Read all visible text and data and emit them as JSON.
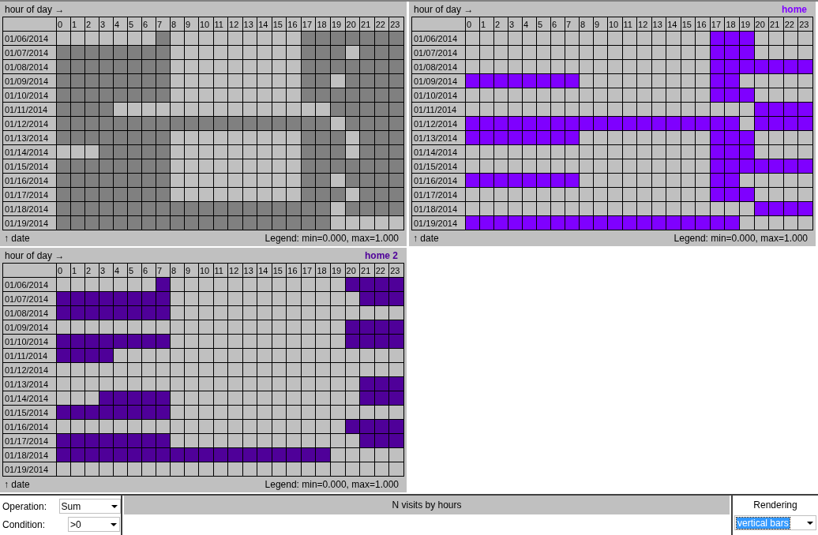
{
  "panels": [
    {
      "x_axis": "hour of day →",
      "y_axis": "↑ date",
      "legend": "Legend: min=0.000, max=1.000",
      "color": "#808080",
      "hours": [
        "0",
        "1",
        "2",
        "3",
        "4",
        "5",
        "6",
        "7",
        "8",
        "9",
        "10",
        "11",
        "12",
        "13",
        "14",
        "15",
        "16",
        "17",
        "18",
        "19",
        "20",
        "21",
        "22",
        "23"
      ],
      "rows": [
        {
          "date": "01/06/2014",
          "cells": [
            false,
            false,
            false,
            false,
            false,
            false,
            false,
            true,
            false,
            false,
            false,
            false,
            false,
            false,
            false,
            false,
            false,
            true,
            true,
            true,
            true,
            true,
            true,
            true
          ]
        },
        {
          "date": "01/07/2014",
          "cells": [
            true,
            true,
            true,
            true,
            true,
            true,
            true,
            true,
            false,
            false,
            false,
            false,
            false,
            false,
            false,
            false,
            false,
            true,
            true,
            true,
            false,
            true,
            true,
            true
          ]
        },
        {
          "date": "01/08/2014",
          "cells": [
            true,
            true,
            true,
            true,
            true,
            true,
            true,
            true,
            false,
            false,
            false,
            false,
            false,
            false,
            false,
            false,
            false,
            true,
            true,
            true,
            true,
            true,
            true,
            true
          ]
        },
        {
          "date": "01/09/2014",
          "cells": [
            true,
            true,
            true,
            true,
            true,
            true,
            true,
            true,
            false,
            false,
            false,
            false,
            false,
            false,
            false,
            false,
            false,
            true,
            true,
            false,
            true,
            true,
            true,
            true
          ]
        },
        {
          "date": "01/10/2014",
          "cells": [
            true,
            true,
            true,
            true,
            true,
            true,
            true,
            true,
            false,
            false,
            false,
            false,
            false,
            false,
            false,
            false,
            false,
            true,
            true,
            true,
            true,
            true,
            true,
            true
          ]
        },
        {
          "date": "01/11/2014",
          "cells": [
            true,
            true,
            true,
            true,
            false,
            false,
            false,
            false,
            false,
            false,
            false,
            false,
            false,
            false,
            false,
            false,
            false,
            false,
            false,
            true,
            true,
            true,
            true,
            true
          ]
        },
        {
          "date": "01/12/2014",
          "cells": [
            true,
            true,
            true,
            true,
            true,
            true,
            true,
            true,
            true,
            true,
            true,
            true,
            true,
            true,
            true,
            true,
            true,
            true,
            true,
            false,
            true,
            true,
            true,
            true
          ]
        },
        {
          "date": "01/13/2014",
          "cells": [
            true,
            true,
            true,
            true,
            true,
            true,
            true,
            true,
            false,
            false,
            false,
            false,
            false,
            false,
            false,
            false,
            false,
            true,
            true,
            true,
            false,
            true,
            true,
            true
          ]
        },
        {
          "date": "01/14/2014",
          "cells": [
            false,
            false,
            false,
            true,
            true,
            true,
            true,
            true,
            false,
            false,
            false,
            false,
            false,
            false,
            false,
            false,
            false,
            true,
            true,
            true,
            false,
            true,
            true,
            true
          ]
        },
        {
          "date": "01/15/2014",
          "cells": [
            true,
            true,
            true,
            true,
            true,
            true,
            true,
            true,
            false,
            false,
            false,
            false,
            false,
            false,
            false,
            false,
            false,
            true,
            true,
            true,
            true,
            true,
            true,
            true
          ]
        },
        {
          "date": "01/16/2014",
          "cells": [
            true,
            true,
            true,
            true,
            true,
            true,
            true,
            true,
            false,
            false,
            false,
            false,
            false,
            false,
            false,
            false,
            false,
            true,
            true,
            false,
            true,
            true,
            true,
            true
          ]
        },
        {
          "date": "01/17/2014",
          "cells": [
            true,
            true,
            true,
            true,
            true,
            true,
            true,
            true,
            false,
            false,
            false,
            false,
            false,
            false,
            false,
            false,
            false,
            true,
            true,
            true,
            false,
            true,
            true,
            true
          ]
        },
        {
          "date": "01/18/2014",
          "cells": [
            true,
            true,
            true,
            true,
            true,
            true,
            true,
            true,
            true,
            true,
            true,
            true,
            true,
            true,
            true,
            true,
            true,
            true,
            true,
            false,
            true,
            true,
            true,
            true
          ]
        },
        {
          "date": "01/19/2014",
          "cells": [
            true,
            true,
            true,
            true,
            true,
            true,
            true,
            true,
            true,
            true,
            true,
            true,
            true,
            true,
            true,
            true,
            true,
            true,
            true,
            false,
            false,
            false,
            false,
            false
          ]
        }
      ]
    },
    {
      "title": "home",
      "x_axis": "hour of day →",
      "y_axis": "↑ date",
      "legend": "Legend: min=0.000, max=1.000",
      "color": "#7f00ff",
      "hours": [
        "0",
        "1",
        "2",
        "3",
        "4",
        "5",
        "6",
        "7",
        "8",
        "9",
        "10",
        "11",
        "12",
        "13",
        "14",
        "15",
        "16",
        "17",
        "18",
        "19",
        "20",
        "21",
        "22",
        "23"
      ],
      "rows": [
        {
          "date": "01/06/2014",
          "cells": [
            false,
            false,
            false,
            false,
            false,
            false,
            false,
            false,
            false,
            false,
            false,
            false,
            false,
            false,
            false,
            false,
            false,
            true,
            true,
            true,
            false,
            false,
            false,
            false
          ]
        },
        {
          "date": "01/07/2014",
          "cells": [
            false,
            false,
            false,
            false,
            false,
            false,
            false,
            false,
            false,
            false,
            false,
            false,
            false,
            false,
            false,
            false,
            false,
            true,
            true,
            true,
            false,
            false,
            false,
            false
          ]
        },
        {
          "date": "01/08/2014",
          "cells": [
            false,
            false,
            false,
            false,
            false,
            false,
            false,
            false,
            false,
            false,
            false,
            false,
            false,
            false,
            false,
            false,
            false,
            true,
            true,
            true,
            true,
            true,
            true,
            true
          ]
        },
        {
          "date": "01/09/2014",
          "cells": [
            true,
            true,
            true,
            true,
            true,
            true,
            true,
            true,
            false,
            false,
            false,
            false,
            false,
            false,
            false,
            false,
            false,
            true,
            true,
            false,
            false,
            false,
            false,
            false
          ]
        },
        {
          "date": "01/10/2014",
          "cells": [
            false,
            false,
            false,
            false,
            false,
            false,
            false,
            false,
            false,
            false,
            false,
            false,
            false,
            false,
            false,
            false,
            false,
            true,
            true,
            true,
            false,
            false,
            false,
            false
          ]
        },
        {
          "date": "01/11/2014",
          "cells": [
            false,
            false,
            false,
            false,
            false,
            false,
            false,
            false,
            false,
            false,
            false,
            false,
            false,
            false,
            false,
            false,
            false,
            false,
            false,
            false,
            true,
            true,
            true,
            true
          ]
        },
        {
          "date": "01/12/2014",
          "cells": [
            true,
            true,
            true,
            true,
            true,
            true,
            true,
            true,
            true,
            true,
            true,
            true,
            true,
            true,
            true,
            true,
            true,
            true,
            true,
            false,
            true,
            true,
            true,
            true
          ]
        },
        {
          "date": "01/13/2014",
          "cells": [
            true,
            true,
            true,
            true,
            true,
            true,
            true,
            true,
            false,
            false,
            false,
            false,
            false,
            false,
            false,
            false,
            false,
            true,
            true,
            true,
            false,
            false,
            false,
            false
          ]
        },
        {
          "date": "01/14/2014",
          "cells": [
            false,
            false,
            false,
            false,
            false,
            false,
            false,
            false,
            false,
            false,
            false,
            false,
            false,
            false,
            false,
            false,
            false,
            true,
            true,
            true,
            false,
            false,
            false,
            false
          ]
        },
        {
          "date": "01/15/2014",
          "cells": [
            false,
            false,
            false,
            false,
            false,
            false,
            false,
            false,
            false,
            false,
            false,
            false,
            false,
            false,
            false,
            false,
            false,
            true,
            true,
            true,
            true,
            true,
            true,
            true
          ]
        },
        {
          "date": "01/16/2014",
          "cells": [
            true,
            true,
            true,
            true,
            true,
            true,
            true,
            true,
            false,
            false,
            false,
            false,
            false,
            false,
            false,
            false,
            false,
            true,
            true,
            false,
            false,
            false,
            false,
            false
          ]
        },
        {
          "date": "01/17/2014",
          "cells": [
            false,
            false,
            false,
            false,
            false,
            false,
            false,
            false,
            false,
            false,
            false,
            false,
            false,
            false,
            false,
            false,
            false,
            true,
            true,
            true,
            false,
            false,
            false,
            false
          ]
        },
        {
          "date": "01/18/2014",
          "cells": [
            false,
            false,
            false,
            false,
            false,
            false,
            false,
            false,
            false,
            false,
            false,
            false,
            false,
            false,
            false,
            false,
            false,
            false,
            false,
            false,
            true,
            true,
            true,
            true
          ]
        },
        {
          "date": "01/19/2014",
          "cells": [
            true,
            true,
            true,
            true,
            true,
            true,
            true,
            true,
            true,
            true,
            true,
            true,
            true,
            true,
            true,
            true,
            true,
            true,
            true,
            false,
            false,
            false,
            false,
            false
          ]
        }
      ]
    },
    {
      "title": "home 2",
      "x_axis": "hour of day →",
      "y_axis": "↑ date",
      "legend": "Legend: min=0.000, max=1.000",
      "color": "#4f0099",
      "hours": [
        "0",
        "1",
        "2",
        "3",
        "4",
        "5",
        "6",
        "7",
        "8",
        "9",
        "10",
        "11",
        "12",
        "13",
        "14",
        "15",
        "16",
        "17",
        "18",
        "19",
        "20",
        "21",
        "22",
        "23"
      ],
      "rows": [
        {
          "date": "01/06/2014",
          "cells": [
            false,
            false,
            false,
            false,
            false,
            false,
            false,
            true,
            false,
            false,
            false,
            false,
            false,
            false,
            false,
            false,
            false,
            false,
            false,
            false,
            true,
            true,
            true,
            true
          ]
        },
        {
          "date": "01/07/2014",
          "cells": [
            true,
            true,
            true,
            true,
            true,
            true,
            true,
            true,
            false,
            false,
            false,
            false,
            false,
            false,
            false,
            false,
            false,
            false,
            false,
            false,
            false,
            true,
            true,
            true
          ]
        },
        {
          "date": "01/08/2014",
          "cells": [
            true,
            true,
            true,
            true,
            true,
            true,
            true,
            true,
            false,
            false,
            false,
            false,
            false,
            false,
            false,
            false,
            false,
            false,
            false,
            false,
            false,
            false,
            false,
            false
          ]
        },
        {
          "date": "01/09/2014",
          "cells": [
            false,
            false,
            false,
            false,
            false,
            false,
            false,
            false,
            false,
            false,
            false,
            false,
            false,
            false,
            false,
            false,
            false,
            false,
            false,
            false,
            true,
            true,
            true,
            true
          ]
        },
        {
          "date": "01/10/2014",
          "cells": [
            true,
            true,
            true,
            true,
            true,
            true,
            true,
            true,
            false,
            false,
            false,
            false,
            false,
            false,
            false,
            false,
            false,
            false,
            false,
            false,
            true,
            true,
            true,
            true
          ]
        },
        {
          "date": "01/11/2014",
          "cells": [
            true,
            true,
            true,
            true,
            false,
            false,
            false,
            false,
            false,
            false,
            false,
            false,
            false,
            false,
            false,
            false,
            false,
            false,
            false,
            false,
            false,
            false,
            false,
            false
          ]
        },
        {
          "date": "01/12/2014",
          "cells": [
            false,
            false,
            false,
            false,
            false,
            false,
            false,
            false,
            false,
            false,
            false,
            false,
            false,
            false,
            false,
            false,
            false,
            false,
            false,
            false,
            false,
            false,
            false,
            false
          ]
        },
        {
          "date": "01/13/2014",
          "cells": [
            false,
            false,
            false,
            false,
            false,
            false,
            false,
            false,
            false,
            false,
            false,
            false,
            false,
            false,
            false,
            false,
            false,
            false,
            false,
            false,
            false,
            true,
            true,
            true
          ]
        },
        {
          "date": "01/14/2014",
          "cells": [
            false,
            false,
            false,
            true,
            true,
            true,
            true,
            true,
            false,
            false,
            false,
            false,
            false,
            false,
            false,
            false,
            false,
            false,
            false,
            false,
            false,
            true,
            true,
            true
          ]
        },
        {
          "date": "01/15/2014",
          "cells": [
            true,
            true,
            true,
            true,
            true,
            true,
            true,
            true,
            false,
            false,
            false,
            false,
            false,
            false,
            false,
            false,
            false,
            false,
            false,
            false,
            false,
            false,
            false,
            false
          ]
        },
        {
          "date": "01/16/2014",
          "cells": [
            false,
            false,
            false,
            false,
            false,
            false,
            false,
            false,
            false,
            false,
            false,
            false,
            false,
            false,
            false,
            false,
            false,
            false,
            false,
            false,
            true,
            true,
            true,
            true
          ]
        },
        {
          "date": "01/17/2014",
          "cells": [
            true,
            true,
            true,
            true,
            true,
            true,
            true,
            true,
            false,
            false,
            false,
            false,
            false,
            false,
            false,
            false,
            false,
            false,
            false,
            false,
            false,
            true,
            true,
            true
          ]
        },
        {
          "date": "01/18/2014",
          "cells": [
            true,
            true,
            true,
            true,
            true,
            true,
            true,
            true,
            true,
            true,
            true,
            true,
            true,
            true,
            true,
            true,
            true,
            true,
            true,
            false,
            false,
            false,
            false,
            false
          ]
        },
        {
          "date": "01/19/2014",
          "cells": [
            false,
            false,
            false,
            false,
            false,
            false,
            false,
            false,
            false,
            false,
            false,
            false,
            false,
            false,
            false,
            false,
            false,
            false,
            false,
            false,
            false,
            false,
            false,
            false
          ]
        }
      ]
    }
  ],
  "controls": {
    "operation": {
      "label": "Operation:",
      "value": "Sum"
    },
    "condition": {
      "label": "Condition:",
      "value": ">0"
    }
  },
  "chart_title": "N visits by hours",
  "rendering": {
    "label": "Rendering",
    "value": "vertical bars",
    "focused": true
  }
}
